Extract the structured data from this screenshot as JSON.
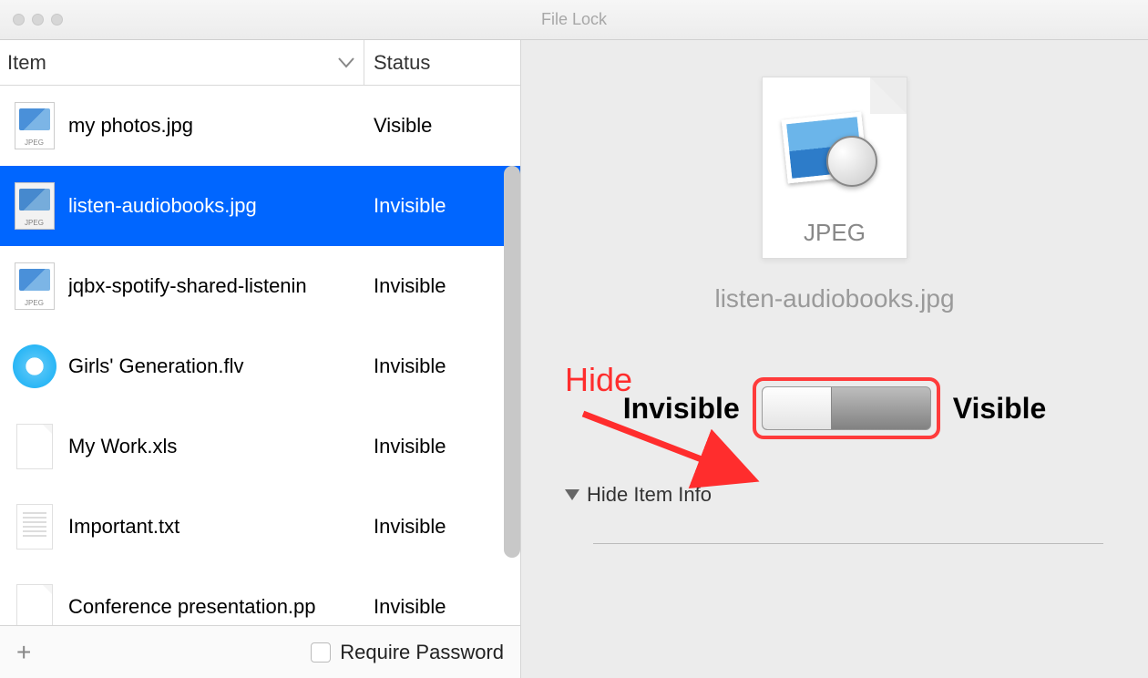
{
  "window": {
    "title": "File Lock"
  },
  "columns": {
    "item": "Item",
    "status": "Status"
  },
  "files": [
    {
      "name": "my photos.jpg",
      "status": "Visible",
      "type": "jpeg",
      "selected": false
    },
    {
      "name": "listen-audiobooks.jpg",
      "status": "Invisible",
      "type": "jpeg",
      "selected": true
    },
    {
      "name": "jqbx-spotify-shared-listenin",
      "status": "Invisible",
      "type": "jpeg",
      "selected": false
    },
    {
      "name": "Girls' Generation.flv",
      "status": "Invisible",
      "type": "flv",
      "selected": false
    },
    {
      "name": "My Work.xls",
      "status": "Invisible",
      "type": "xls",
      "selected": false
    },
    {
      "name": "Important.txt",
      "status": "Invisible",
      "type": "txt",
      "selected": false
    },
    {
      "name": "Conference presentation.pp",
      "status": "Invisible",
      "type": "pp",
      "selected": false
    }
  ],
  "bottom": {
    "require_password": "Require Password"
  },
  "preview": {
    "icon_label": "JPEG",
    "filename": "listen-audiobooks.jpg",
    "invisible": "Invisible",
    "visible": "Visible",
    "hide_info": "Hide Item Info"
  },
  "annotation": {
    "hide": "Hide"
  }
}
